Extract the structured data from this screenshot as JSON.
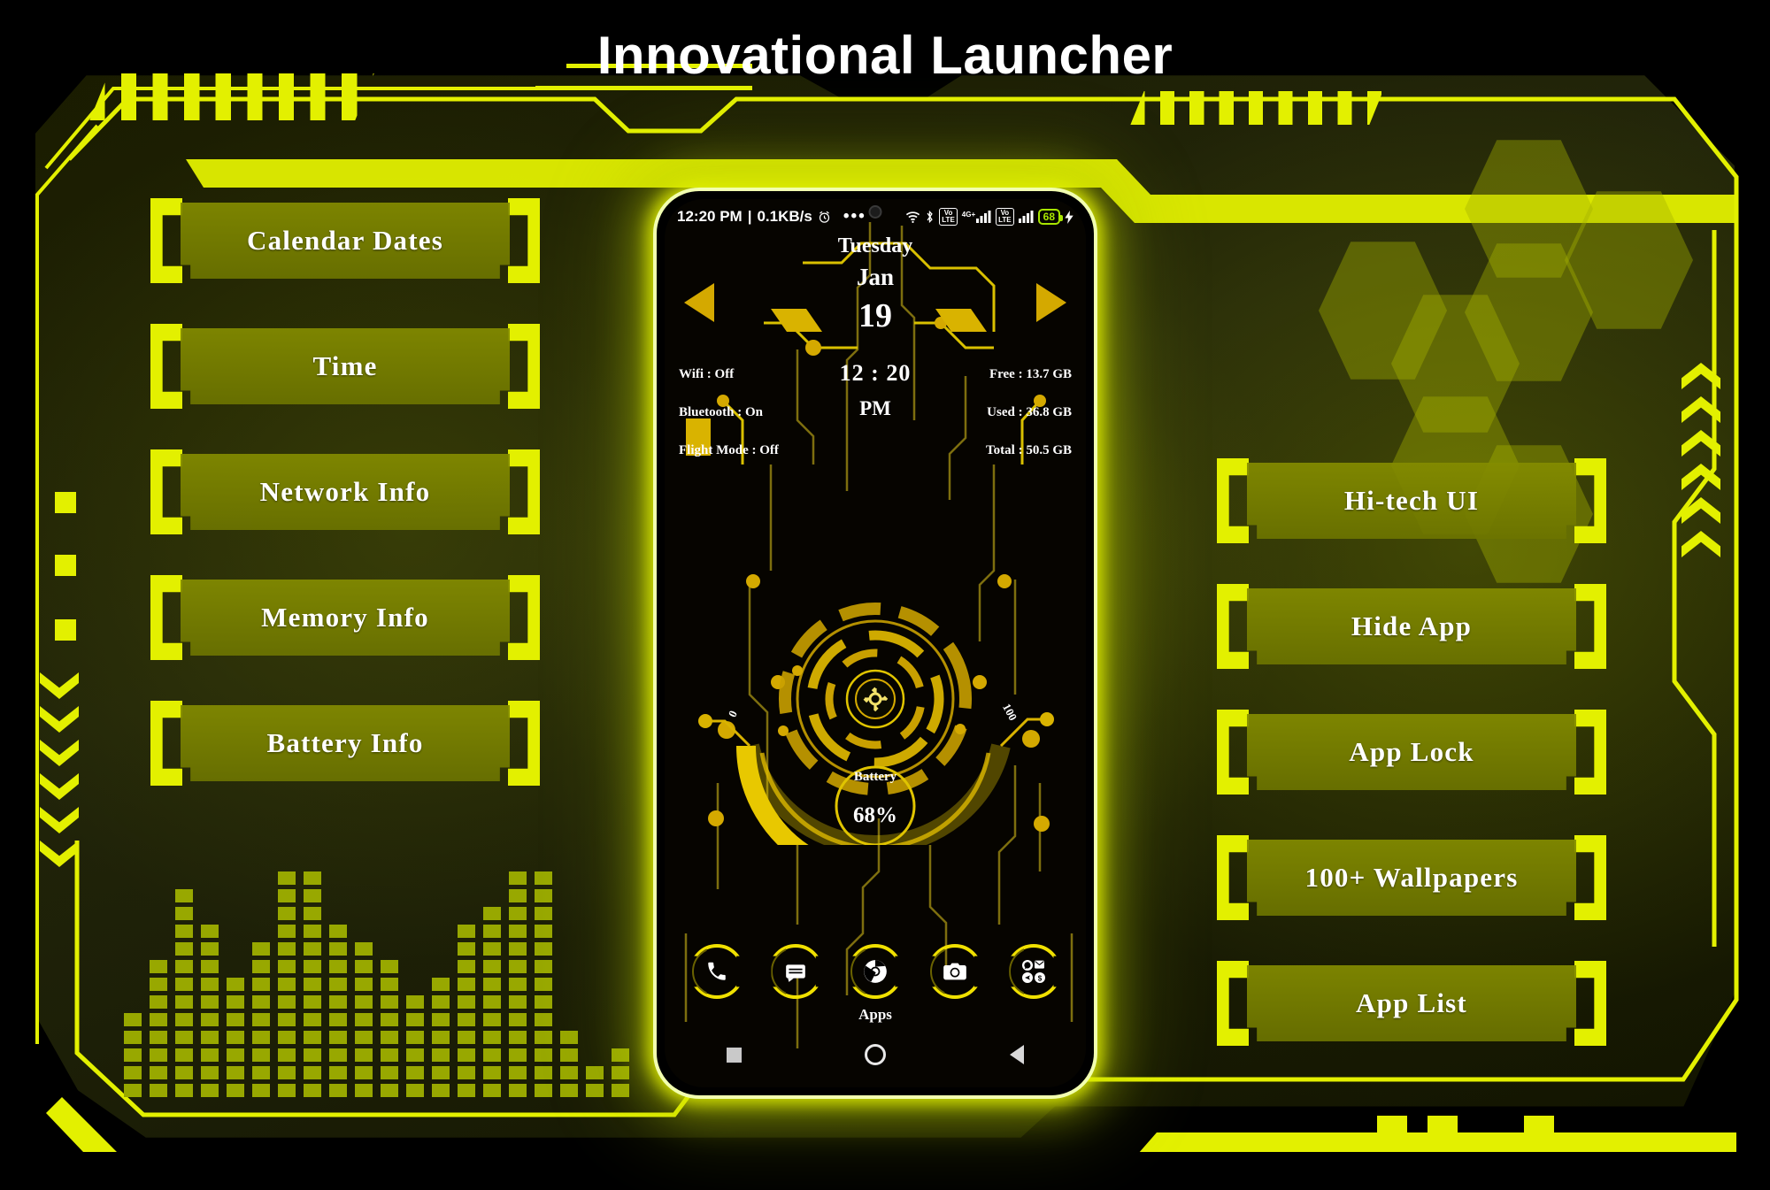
{
  "app": {
    "title": "Innovational Launcher",
    "accent": "#e3f000",
    "panel_bg": "#848c00",
    "text_color": "#ffffff"
  },
  "left_menu": {
    "items": [
      {
        "label": "Calendar Dates",
        "name": "calendar-dates"
      },
      {
        "label": "Time",
        "name": "time"
      },
      {
        "label": "Network Info",
        "name": "network-info"
      },
      {
        "label": "Memory Info",
        "name": "memory-info"
      },
      {
        "label": "Battery Info",
        "name": "battery-info"
      }
    ]
  },
  "right_menu": {
    "items": [
      {
        "label": "Hi-tech UI",
        "name": "hi-tech-ui"
      },
      {
        "label": "Hide App",
        "name": "hide-app"
      },
      {
        "label": "App Lock",
        "name": "app-lock"
      },
      {
        "label": "100+ Wallpapers",
        "name": "wallpapers"
      },
      {
        "label": "App List",
        "name": "app-list"
      }
    ]
  },
  "phone": {
    "statusbar": {
      "clock": "12:20 PM",
      "netspeed": "0.1KB/s",
      "alarm_icon": "alarm-clock-icon",
      "overflow": "•••",
      "wifi_icon": "wifi-icon",
      "bluetooth_icon": "bluetooth-icon",
      "volte_label": "VoLTE",
      "network_type": "4G+",
      "battery_percent": "68",
      "charging_icon": "charging-bolt-icon"
    },
    "date_widget": {
      "weekday": "Tuesday",
      "month": "Jan",
      "day": "19",
      "prev_icon": "chevron-left-icon",
      "next_icon": "chevron-right-icon"
    },
    "clock_widget": {
      "time": "12 : 20",
      "ampm": "PM"
    },
    "left_info": [
      {
        "label": "Wifi : Off",
        "name": "wifi-status"
      },
      {
        "label": "Bluetooth : On",
        "name": "bluetooth-status"
      },
      {
        "label": "Flight Mode : Off",
        "name": "flight-mode-status"
      }
    ],
    "storage_info": [
      {
        "label": "Free : 13.7 GB",
        "name": "storage-free"
      },
      {
        "label": "Used : 36.8 GB",
        "name": "storage-used"
      },
      {
        "label": "Total : 50.5 GB",
        "name": "storage-total"
      }
    ],
    "battery_gauge": {
      "label": "Battery",
      "value": "68%",
      "percent": 68,
      "min_tick": "0",
      "max_tick": "100"
    },
    "dock": {
      "apps_label": "Apps",
      "items": [
        {
          "name": "phone-icon"
        },
        {
          "name": "messages-icon"
        },
        {
          "name": "chrome-icon"
        },
        {
          "name": "camera-icon"
        },
        {
          "name": "app-drawer-icon"
        }
      ]
    },
    "navbar": [
      {
        "name": "recents-button"
      },
      {
        "name": "home-button"
      },
      {
        "name": "back-button"
      }
    ]
  }
}
